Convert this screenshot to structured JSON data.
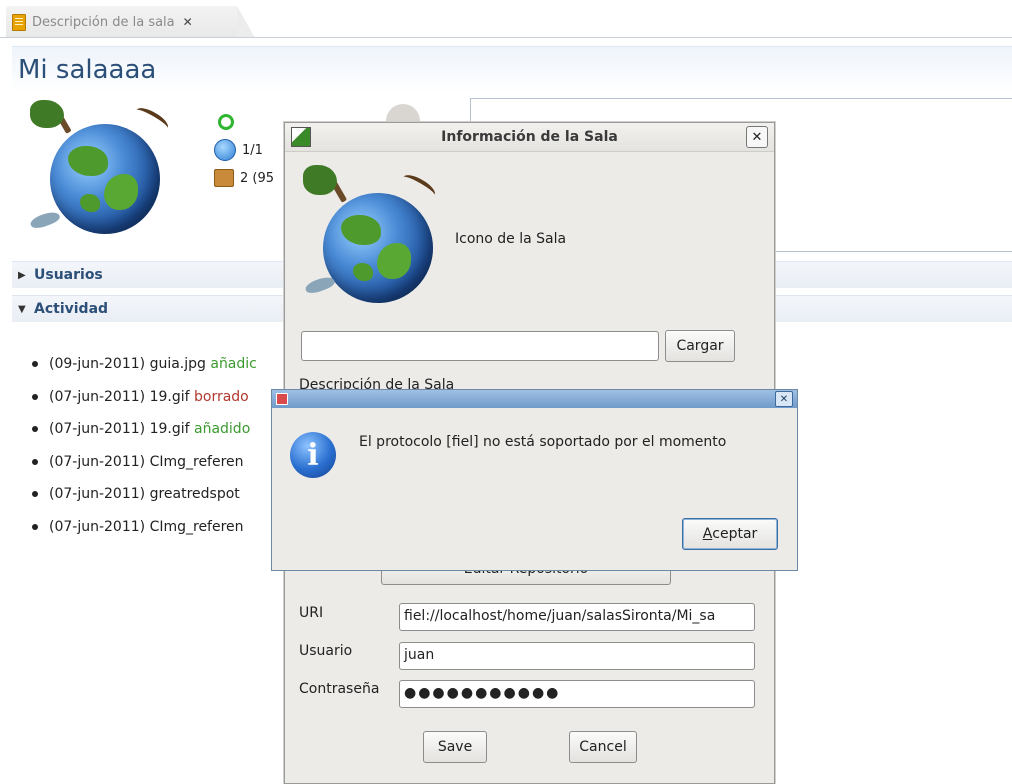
{
  "tab": {
    "label": "Descripción de la sala",
    "close": "✕"
  },
  "room": {
    "title": "Mi salaaaa",
    "users_count": "1/1",
    "files_info": "2 (95"
  },
  "sections": {
    "users": "Usuarios",
    "activity": "Actividad"
  },
  "activity": [
    {
      "date": "(09-jun-2011)",
      "file": "guia.jpg",
      "action": "añadic",
      "action_type": "added"
    },
    {
      "date": "(07-jun-2011)",
      "file": "19.gif",
      "action": "borrado",
      "action_type": "deleted"
    },
    {
      "date": "(07-jun-2011)",
      "file": "19.gif",
      "action": "añadido",
      "action_type": "added"
    },
    {
      "date": "(07-jun-2011)",
      "file": "CImg_referen",
      "action": "",
      "action_type": ""
    },
    {
      "date": "(07-jun-2011)",
      "file": "greatredspot",
      "action": "",
      "action_type": ""
    },
    {
      "date": "(07-jun-2011)",
      "file": "CImg_referen",
      "action": "",
      "action_type": ""
    }
  ],
  "dialog": {
    "title": "Información de la Sala",
    "close": "✕",
    "icon_label": "Icono de la Sala",
    "load_button": "Cargar",
    "description_label": "Descripción de la Sala",
    "repo_button": "Editar Repositorio",
    "uri_label": "URI",
    "uri_value": "fiel://localhost/home/juan/salasSironta/Mi_sa",
    "user_label": "Usuario",
    "user_value": "juan",
    "password_label": "Contraseña",
    "password_value": "●●●●●●●●●●●",
    "save_button": "Save",
    "cancel_button": "Cancel"
  },
  "message": {
    "close": "✕",
    "text": "El protocolo [fiel] no está soportado por el momento",
    "ok_prefix": "A",
    "ok_rest": "ceptar"
  },
  "colors": {
    "added": "#3b9b2f",
    "deleted": "#b0392e",
    "title": "#2c4f78"
  }
}
